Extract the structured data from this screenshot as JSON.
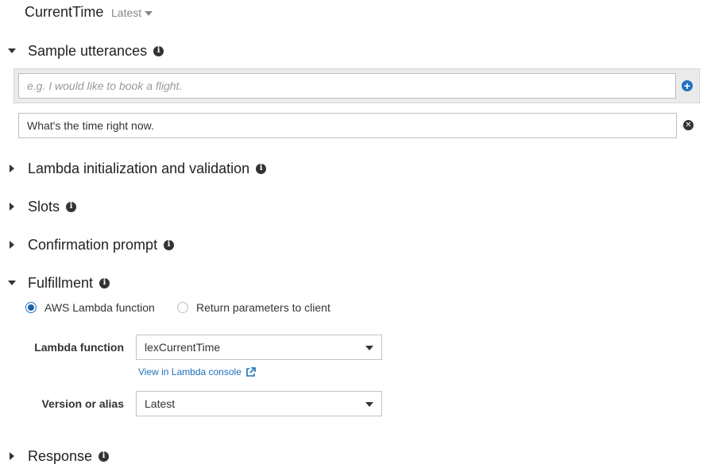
{
  "header": {
    "intent_name": "CurrentTime",
    "version": "Latest"
  },
  "sections": {
    "sample_utterances": {
      "title": "Sample utterances",
      "expanded": true
    },
    "lambda_init": {
      "title": "Lambda initialization and validation",
      "expanded": false
    },
    "slots": {
      "title": "Slots",
      "expanded": false
    },
    "confirmation": {
      "title": "Confirmation prompt",
      "expanded": false
    },
    "fulfillment": {
      "title": "Fulfillment",
      "expanded": true
    },
    "response": {
      "title": "Response",
      "expanded": false
    }
  },
  "utterances": {
    "new_placeholder": "e.g. I would like to book a flight.",
    "new_value": "",
    "items": [
      "What's the time right now."
    ]
  },
  "fulfillment": {
    "options": [
      {
        "label": "AWS Lambda function",
        "selected": true
      },
      {
        "label": "Return parameters to client",
        "selected": false
      }
    ],
    "lambda_function_label": "Lambda function",
    "lambda_function_value": "lexCurrentTime",
    "console_link": "View in Lambda console",
    "version_label": "Version or alias",
    "version_value": "Latest"
  },
  "icons": {
    "info": "info-icon",
    "add": "plus-circle-icon",
    "remove": "close-circle-icon",
    "external": "external-link-icon"
  },
  "colors": {
    "accent": "#1f73c1",
    "link": "#1f6fb8",
    "input_bg_highlight": "#ebebeb"
  }
}
